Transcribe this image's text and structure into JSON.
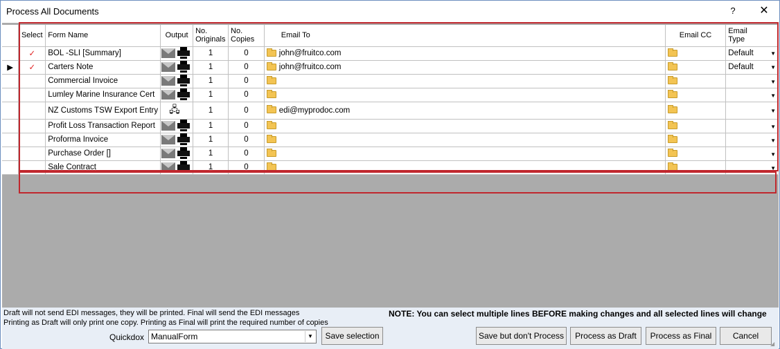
{
  "window": {
    "title": "Process All Documents",
    "help": "?",
    "close": "✕"
  },
  "grid": {
    "headers": {
      "select": "Select",
      "form_name": "Form Name",
      "output": "Output",
      "originals": "No. Originals",
      "copies": "No. Copies",
      "email_to": "Email To",
      "email_cc": "Email CC",
      "email_type": "Email Type"
    },
    "rows": [
      {
        "selected": "✓",
        "name": "BOL -SLI [Summary]",
        "output": "mail-print",
        "originals": "1",
        "copies": "0",
        "email_to": "john@fruitco.com",
        "email_cc": "",
        "email_type": "Default",
        "current": ""
      },
      {
        "selected": "✓",
        "name": "Carters Note",
        "output": "mail-print",
        "originals": "1",
        "copies": "0",
        "email_to": "john@fruitco.com",
        "email_cc": "",
        "email_type": "Default",
        "current": "▶"
      },
      {
        "selected": "",
        "name": "Commercial Invoice",
        "output": "mail-print",
        "originals": "1",
        "copies": "0",
        "email_to": "",
        "email_cc": "",
        "email_type": "",
        "current": ""
      },
      {
        "selected": "",
        "name": "Lumley Marine Insurance Cert",
        "output": "mail-print",
        "originals": "1",
        "copies": "0",
        "email_to": "",
        "email_cc": "",
        "email_type": "",
        "current": ""
      },
      {
        "selected": "",
        "name": "NZ Customs TSW Export Entry",
        "output": "network",
        "originals": "1",
        "copies": "0",
        "email_to": "edi@myprodoc.com",
        "email_cc": "",
        "email_type": "",
        "current": ""
      },
      {
        "selected": "",
        "name": "Profit Loss Transaction Report",
        "output": "mail-print",
        "originals": "1",
        "copies": "0",
        "email_to": "",
        "email_cc": "",
        "email_type": "",
        "current": ""
      },
      {
        "selected": "",
        "name": "Proforma Invoice",
        "output": "mail-print",
        "originals": "1",
        "copies": "0",
        "email_to": "",
        "email_cc": "",
        "email_type": "",
        "current": ""
      },
      {
        "selected": "",
        "name": "Purchase Order []",
        "output": "mail-print",
        "originals": "1",
        "copies": "0",
        "email_to": "",
        "email_cc": "",
        "email_type": "",
        "current": ""
      },
      {
        "selected": "",
        "name": "Sale Contract",
        "output": "mail-print",
        "originals": "1",
        "copies": "0",
        "email_to": "",
        "email_cc": "",
        "email_type": "",
        "current": ""
      }
    ]
  },
  "footer": {
    "note1": "Draft will not send EDI messages, they will be printed.  Final will send the EDI messages",
    "note2": "Printing as Draft will only print one copy.  Printing as Final will print the required number of copies",
    "note_bold": "NOTE:  You can select multiple lines BEFORE making changes and all selected lines will change",
    "quickdox_label": "Quickdox",
    "quickdox_value": "ManualForm",
    "save_selection": "Save selection",
    "save_no_process": "Save but don't Process",
    "process_draft": "Process as Draft",
    "process_final": "Process as Final",
    "cancel": "Cancel"
  },
  "colors": {
    "highlight": "#c0272d",
    "check": "#e02020",
    "footer_bg": "#e8eef6",
    "grid_bg": "#ababab"
  }
}
